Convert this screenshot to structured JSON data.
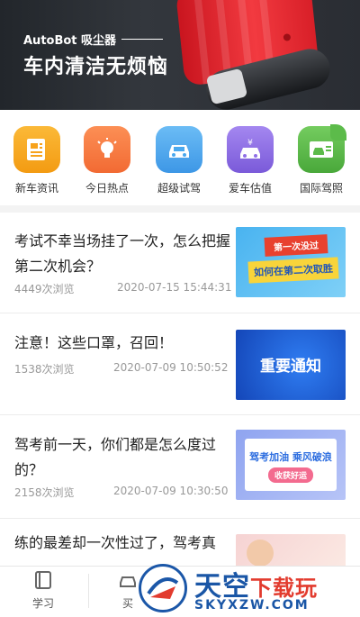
{
  "banner": {
    "brand": "AutoBot 吸尘器",
    "title": "车内清洁无烦恼"
  },
  "categories": [
    {
      "label": "新车资讯",
      "icon": "news-document-icon",
      "color": "#f7a21b"
    },
    {
      "label": "今日热点",
      "icon": "lightbulb-icon",
      "color": "#f7793e"
    },
    {
      "label": "超级试驾",
      "icon": "car-icon",
      "color": "#4aa8ee"
    },
    {
      "label": "爱车估值",
      "icon": "car-yen-icon",
      "color": "#8f6fe6"
    },
    {
      "label": "国际驾照",
      "icon": "driver-license-icon",
      "color": "#5cbb4a"
    }
  ],
  "articles": [
    {
      "title": "考试不幸当场挂了一次，怎么把握第二次机会？",
      "views": "4449次浏览",
      "date": "2020-07-15 15:44:31",
      "thumb": {
        "line1": "第一次没过",
        "line2": "如何在第二次取胜"
      }
    },
    {
      "title": "注意！这些口罩，召回！",
      "views": "1538次浏览",
      "date": "2020-07-09 10:50:52",
      "thumb": {
        "line1": "重要通知"
      }
    },
    {
      "title": "驾考前一天，你们都是怎么度过的？",
      "views": "2158次浏览",
      "date": "2020-07-09 10:30:50",
      "thumb": {
        "line1": "驾考加油 乘风破浪",
        "line2": "收获好运"
      }
    },
    {
      "title": "练的最差却一次性过了，驾考真"
    }
  ],
  "tabbar": {
    "study": "学习",
    "buy": "买"
  },
  "watermark": {
    "cn_main": "天空",
    "cn_sub": "下载玩",
    "en": "SKYXZW.COM"
  }
}
